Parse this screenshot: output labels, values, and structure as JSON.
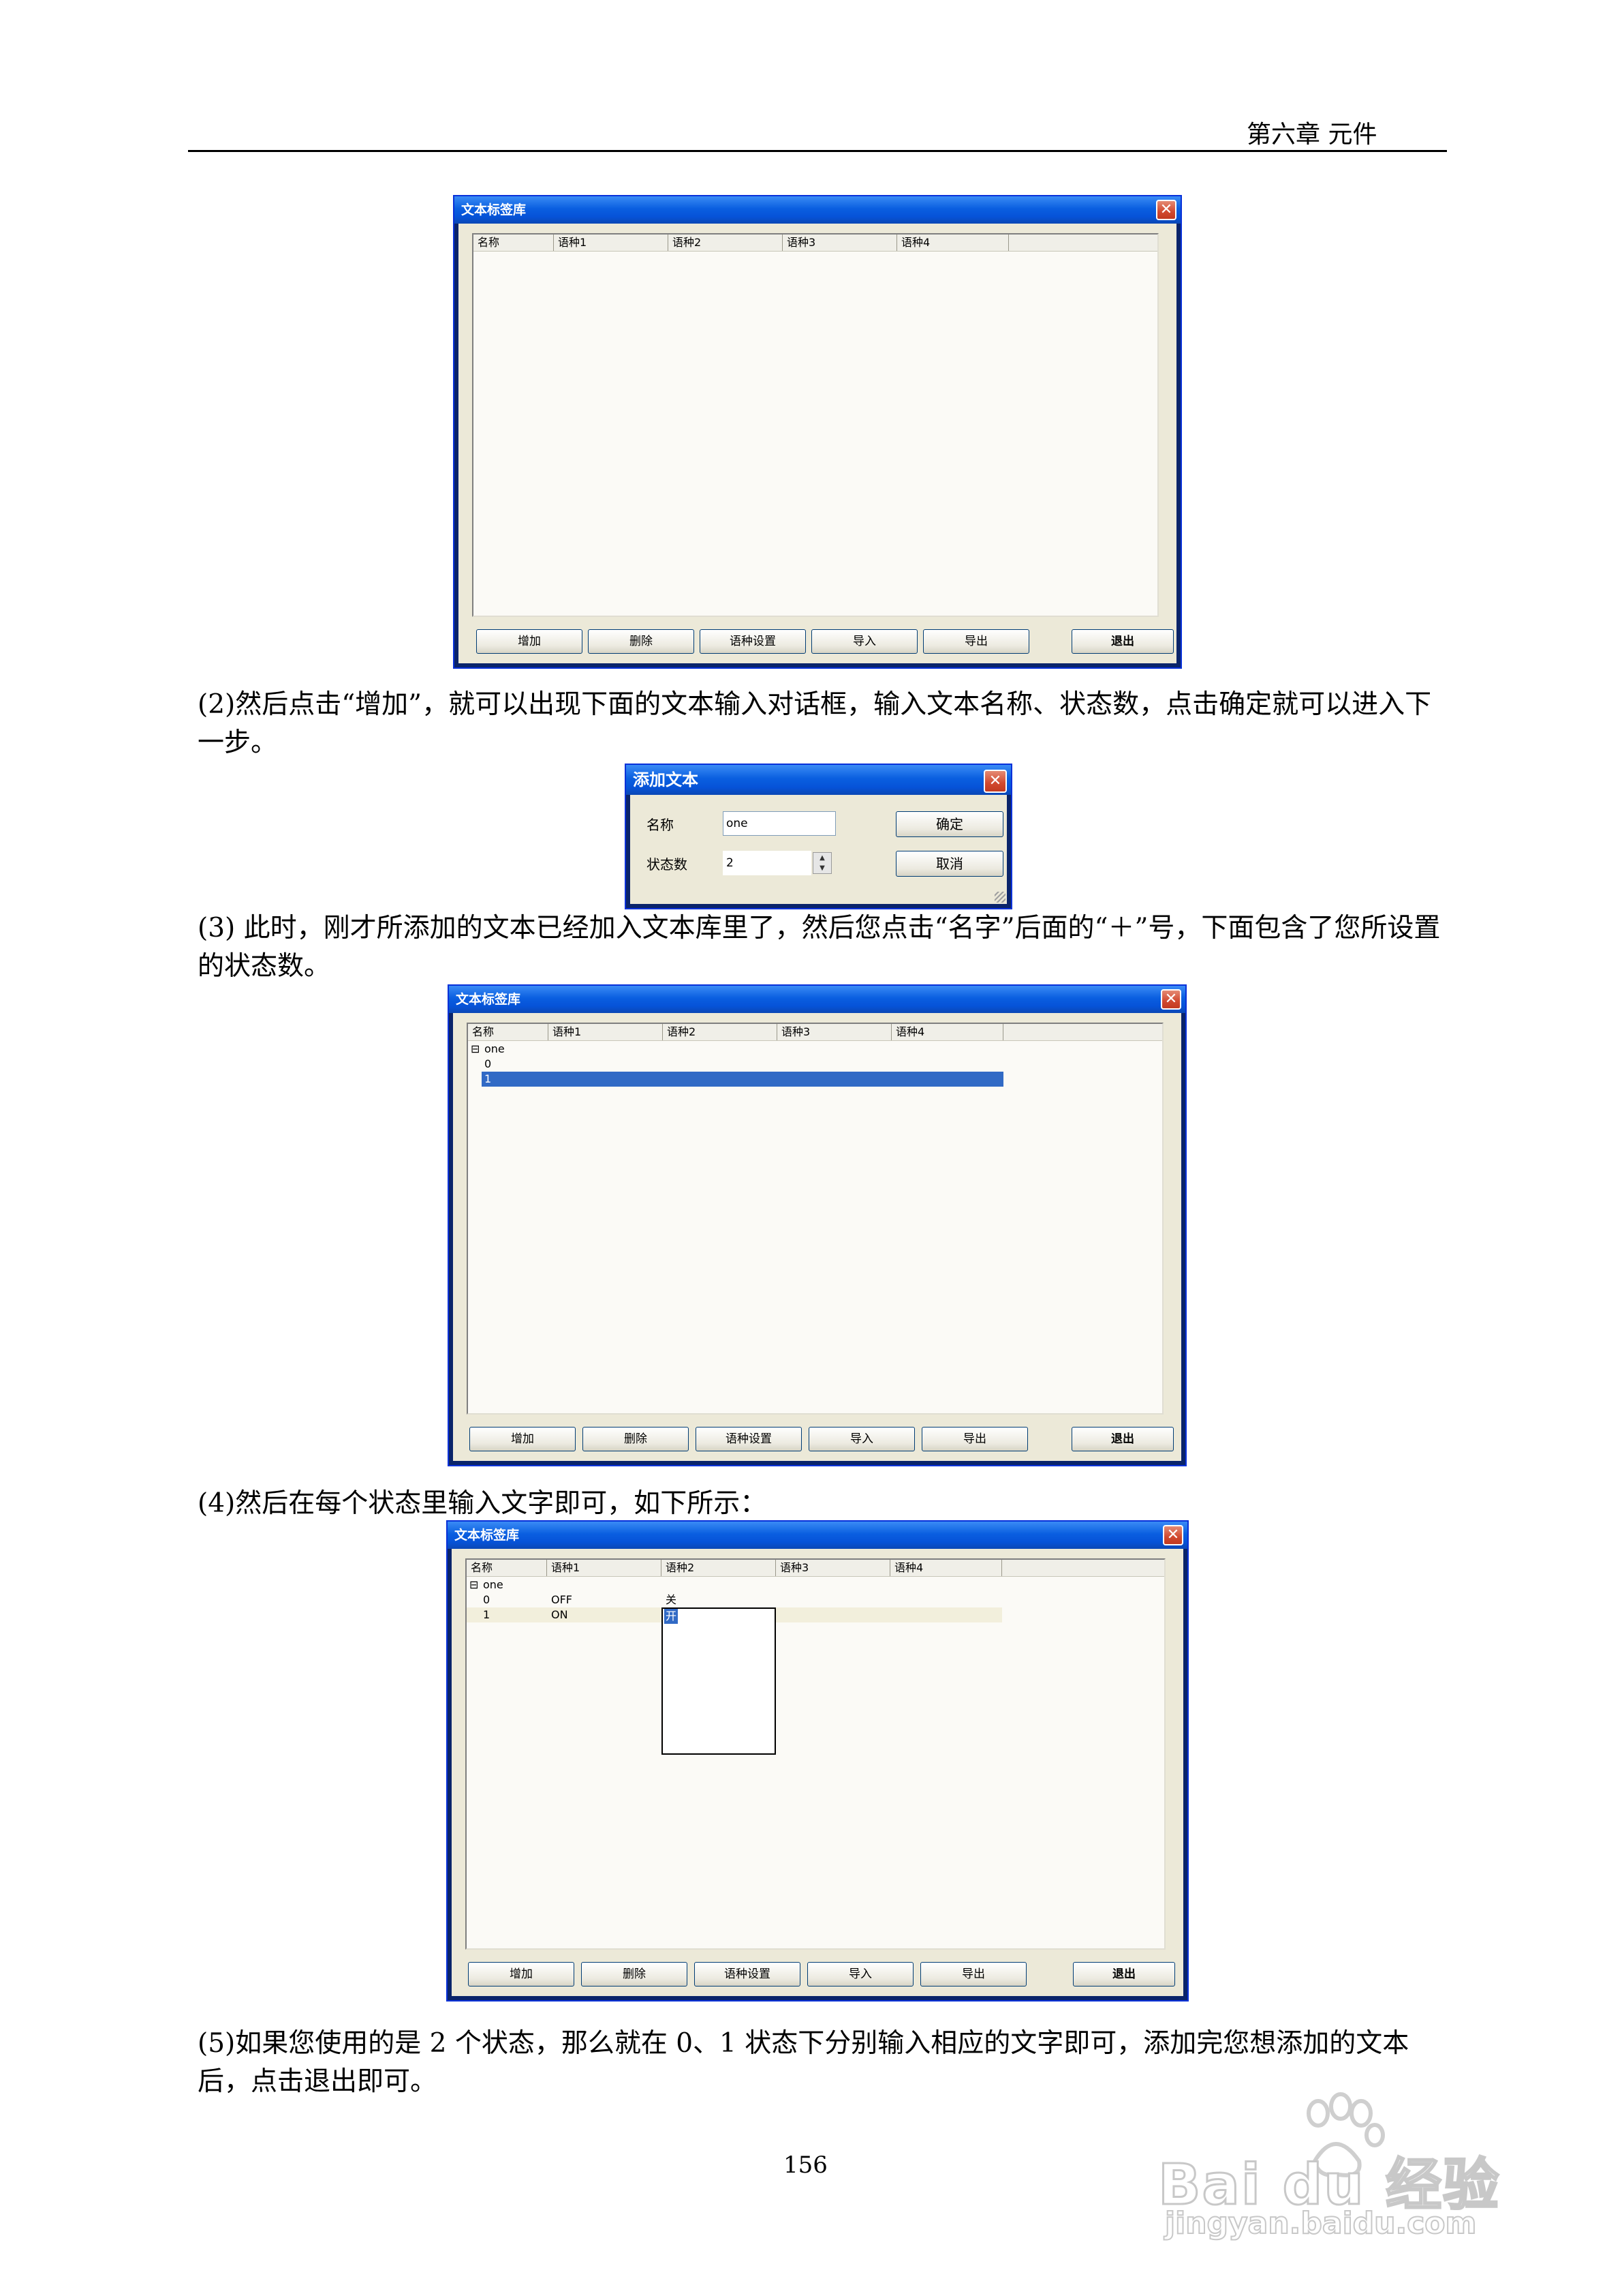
{
  "header": {
    "chapter": "第六章  元件"
  },
  "paragraphs": {
    "p2": "(2)然后点击“增加”，就可以出现下面的文本输入对话框，输入文本名称、状态数，点击确定就可以进入下一步。",
    "p3": "(3) 此时，刚才所添加的文本已经加入文本库里了，然后您点击“名字”后面的“＋”号，下面包含了您所设置的状态数。",
    "p4": "(4)然后在每个状态里输入文字即可，如下所示：",
    "p5": "(5)如果您使用的是 2 个状态，那么就在 0、1 状态下分别输入相应的文字即可，添加完您想添加的文本后，点击退出即可。"
  },
  "library_window": {
    "title": "文本标签库",
    "close": "✕",
    "columns": [
      "名称",
      "语种1",
      "语种2",
      "语种3",
      "语种4"
    ],
    "buttons": {
      "add": "增加",
      "delete": "删除",
      "lang_settings": "语种设置",
      "import": "导入",
      "export": "导出",
      "exit": "退出"
    }
  },
  "tree": {
    "node": "one",
    "expander": "⊟",
    "states": [
      "0",
      "1"
    ]
  },
  "filled": {
    "row0": {
      "lang1": "OFF",
      "lang2": "关"
    },
    "row1": {
      "lang1": "ON",
      "lang2": "开"
    }
  },
  "add_dialog": {
    "title": "添加文本",
    "close": "✕",
    "name_label": "名称",
    "name_value": "one",
    "state_label": "状态数",
    "state_value": "2",
    "ok": "确定",
    "cancel": "取消"
  },
  "page_number": "156",
  "watermark": {
    "brand": "Bai du 经验",
    "url": "jingyan.baidu.com"
  }
}
